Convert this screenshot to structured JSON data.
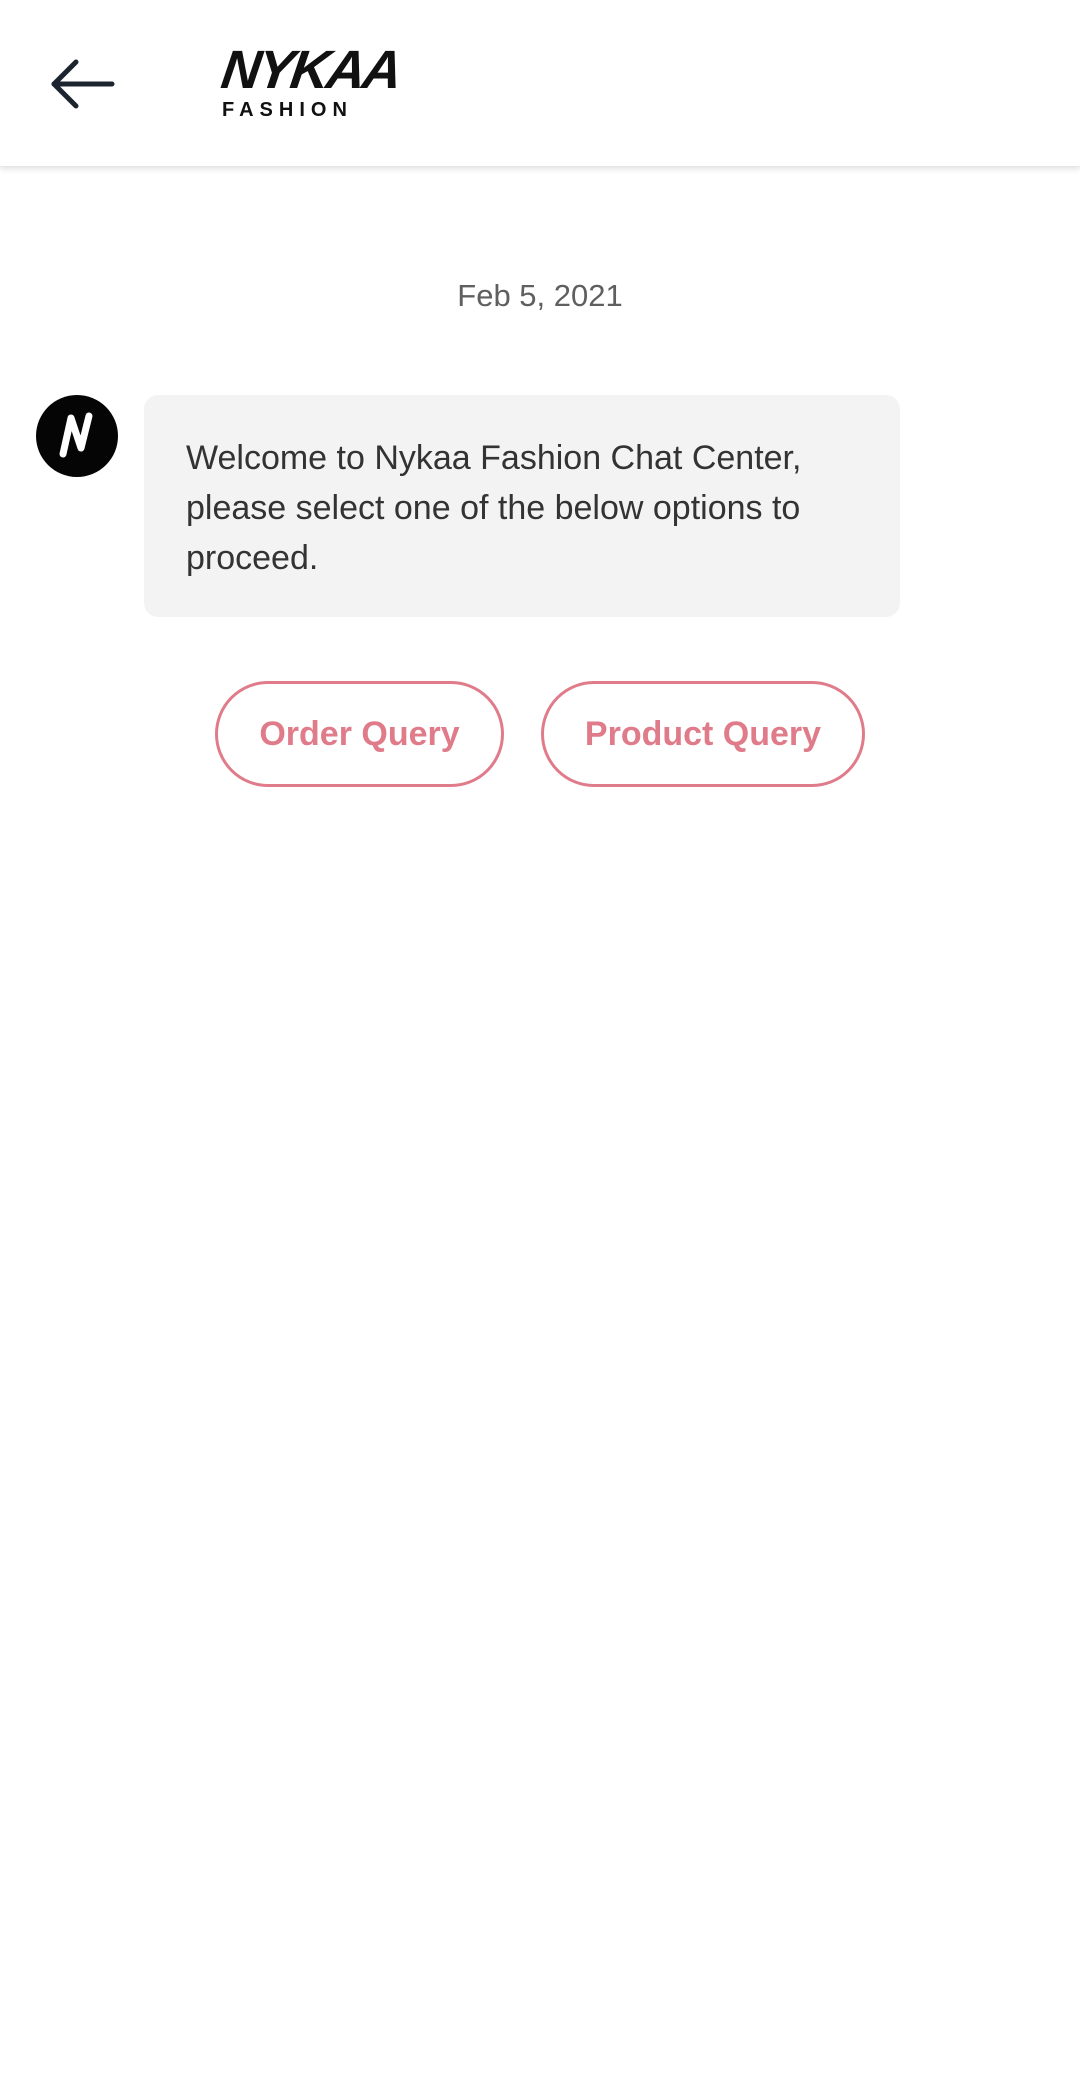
{
  "header": {
    "back_icon": "arrow-left-icon",
    "logo": {
      "wordmark": "NYKAA",
      "subtitle": "FASHION"
    }
  },
  "chat": {
    "date": "Feb 5, 2021",
    "bot_avatar_letter": "N",
    "message": "Welcome to Nykaa Fashion Chat Center, please select one of the below options to proceed.",
    "options": [
      {
        "label": "Order Query"
      },
      {
        "label": "Product Query"
      }
    ]
  },
  "colors": {
    "accent": "#e07b8a",
    "bubble_bg": "#f3f3f3",
    "text": "#333333",
    "date_text": "#5f5f5f"
  }
}
